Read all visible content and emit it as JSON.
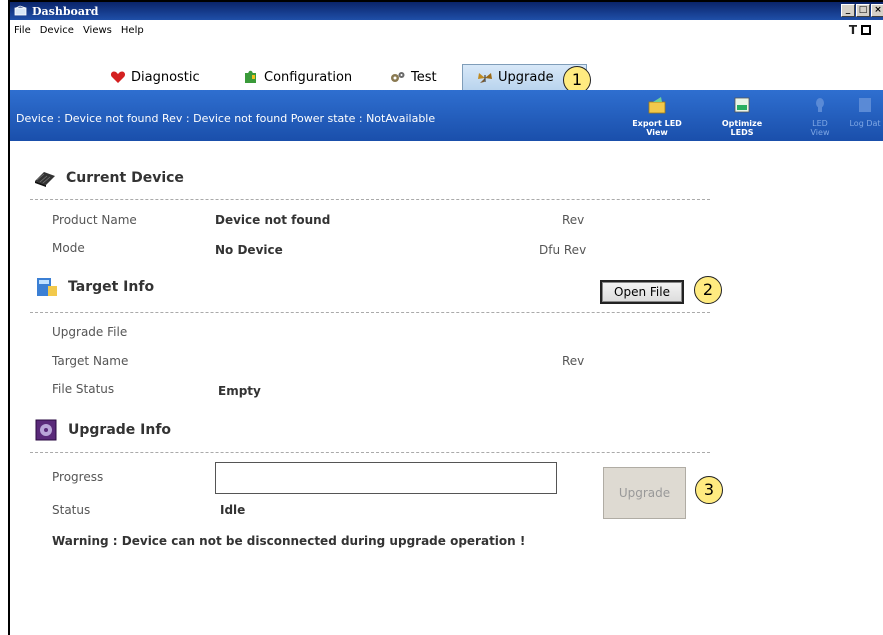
{
  "window": {
    "title": "Dashboard",
    "controls": [
      "_",
      "□",
      "×"
    ]
  },
  "menu": {
    "items": [
      "File",
      "Device",
      "Views",
      "Help"
    ],
    "right_label": "T"
  },
  "tabs": [
    {
      "label": "Diagnostic",
      "icon": "heart-icon"
    },
    {
      "label": "Configuration",
      "icon": "puzzle-icon"
    },
    {
      "label": "Test",
      "icon": "gears-icon"
    },
    {
      "label": "Upgrade",
      "icon": "butterfly-icon",
      "active": true
    }
  ],
  "device_bar": {
    "status_text": "Device :  Device not found Rev :  Device not found Power state :  NotAvailable",
    "tools": [
      {
        "label": "Export LED View",
        "enabled": true
      },
      {
        "label": "Optimize LEDS",
        "enabled": true
      },
      {
        "label": "LED View",
        "enabled": false
      },
      {
        "label": "Log Dat",
        "enabled": false
      }
    ]
  },
  "callouts": [
    "1",
    "2",
    "3"
  ],
  "current_device": {
    "heading": "Current Device",
    "product_name_label": "Product Name",
    "product_name_value": "Device not found",
    "rev_label": "Rev",
    "mode_label": "Mode",
    "mode_value": "No Device",
    "dfu_rev_label": "Dfu Rev"
  },
  "target_info": {
    "heading": "Target Info",
    "open_file_label": "Open File",
    "upgrade_file_label": "Upgrade File",
    "target_name_label": "Target Name",
    "rev_label": "Rev",
    "file_status_label": "File Status",
    "file_status_value": "Empty"
  },
  "upgrade_info": {
    "heading": "Upgrade Info",
    "progress_label": "Progress",
    "progress_value": 0,
    "status_label": "Status",
    "status_value": "Idle",
    "upgrade_button_label": "Upgrade",
    "warning": "Warning : Device can not be disconnected during upgrade operation !"
  },
  "colors": {
    "title_bar": "#0a246a",
    "device_bar": "#1a4fab",
    "callout_fill": "#ffeb80"
  }
}
